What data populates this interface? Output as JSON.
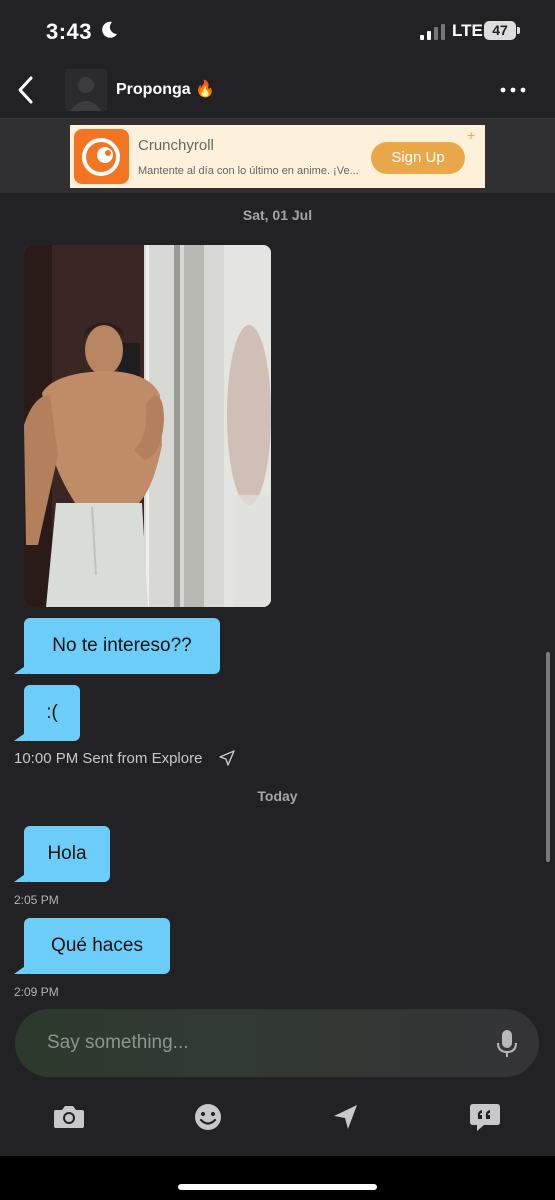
{
  "status_bar": {
    "time": "3:43",
    "network": "LTE",
    "battery": "47"
  },
  "header": {
    "contact_name": "Proponga 🔥"
  },
  "ad": {
    "brand": "Crunchyroll",
    "text": "Mantente al día con lo último en anime. ¡Ve...",
    "cta": "Sign Up",
    "accent": "#f47521"
  },
  "chat": {
    "date_1": "Sat, 01 Jul",
    "messages_old": [
      {
        "text": "No te intereso??"
      },
      {
        "text": ":("
      }
    ],
    "old_meta": "10:00 PM Sent from Explore",
    "date_2": "Today",
    "messages_today": [
      {
        "text": "Hola",
        "time": "2:05 PM"
      },
      {
        "text": "Qué haces",
        "time": "2:09 PM"
      }
    ],
    "bubble_color": "#6ccdf8"
  },
  "composer": {
    "placeholder": "Say something..."
  }
}
